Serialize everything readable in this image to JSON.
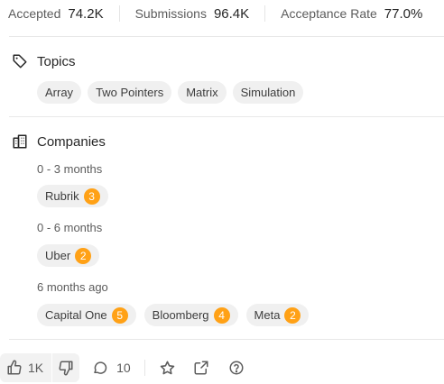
{
  "stats": {
    "accepted_label": "Accepted",
    "accepted_value": "74.2K",
    "submissions_label": "Submissions",
    "submissions_value": "96.4K",
    "acceptance_label": "Acceptance Rate",
    "acceptance_value": "77.0%"
  },
  "topics": {
    "title": "Topics",
    "icon": "tag-icon",
    "items": [
      "Array",
      "Two Pointers",
      "Matrix",
      "Simulation"
    ]
  },
  "companies": {
    "title": "Companies",
    "icon": "building-icon",
    "groups": [
      {
        "period": "0 - 3 months",
        "items": [
          {
            "name": "Rubrik",
            "count": "3"
          }
        ]
      },
      {
        "period": "0 - 6 months",
        "items": [
          {
            "name": "Uber",
            "count": "2"
          }
        ]
      },
      {
        "period": "6 months ago",
        "items": [
          {
            "name": "Capital One",
            "count": "5"
          },
          {
            "name": "Bloomberg",
            "count": "4"
          },
          {
            "name": "Meta",
            "count": "2"
          }
        ]
      }
    ]
  },
  "footer": {
    "likes": "1K",
    "comments": "10",
    "icons": [
      "thumbs-up-icon",
      "thumbs-down-icon",
      "comment-icon",
      "star-icon",
      "share-icon",
      "help-icon"
    ]
  },
  "colors": {
    "badge": "#ffa116",
    "chip_bg": "#f0f0f0"
  }
}
